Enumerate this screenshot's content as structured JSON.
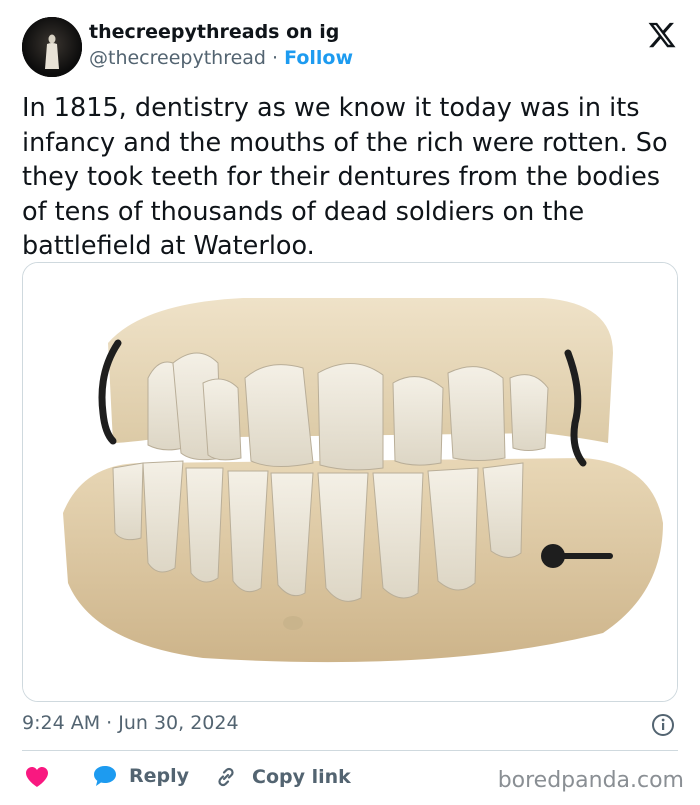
{
  "author": {
    "display_name": "thecreepythreads on ig",
    "handle": "@thecreepythread",
    "separator": " · ",
    "follow_label": "Follow"
  },
  "tweet": {
    "text": "In 1815, dentistry as we know it today was in its infancy and the mouths of the rich were rotten. So they took teeth for their dentures from the bodies of tens of thousands of dead soldiers on the battlefield at Waterloo.",
    "timestamp": "9:24 AM · Jun 30, 2024"
  },
  "actions": {
    "reply_label": "Reply",
    "copy_link_label": "Copy link"
  },
  "icons": {
    "platform": "x-logo-icon",
    "info": "info-icon",
    "like": "heart-icon",
    "reply": "speech-bubble-icon",
    "copy": "link-icon"
  },
  "colors": {
    "text": "#0f1419",
    "secondary": "#536471",
    "accent": "#1d9bf0",
    "like": "#f91880"
  },
  "watermark": "boredpanda.com"
}
